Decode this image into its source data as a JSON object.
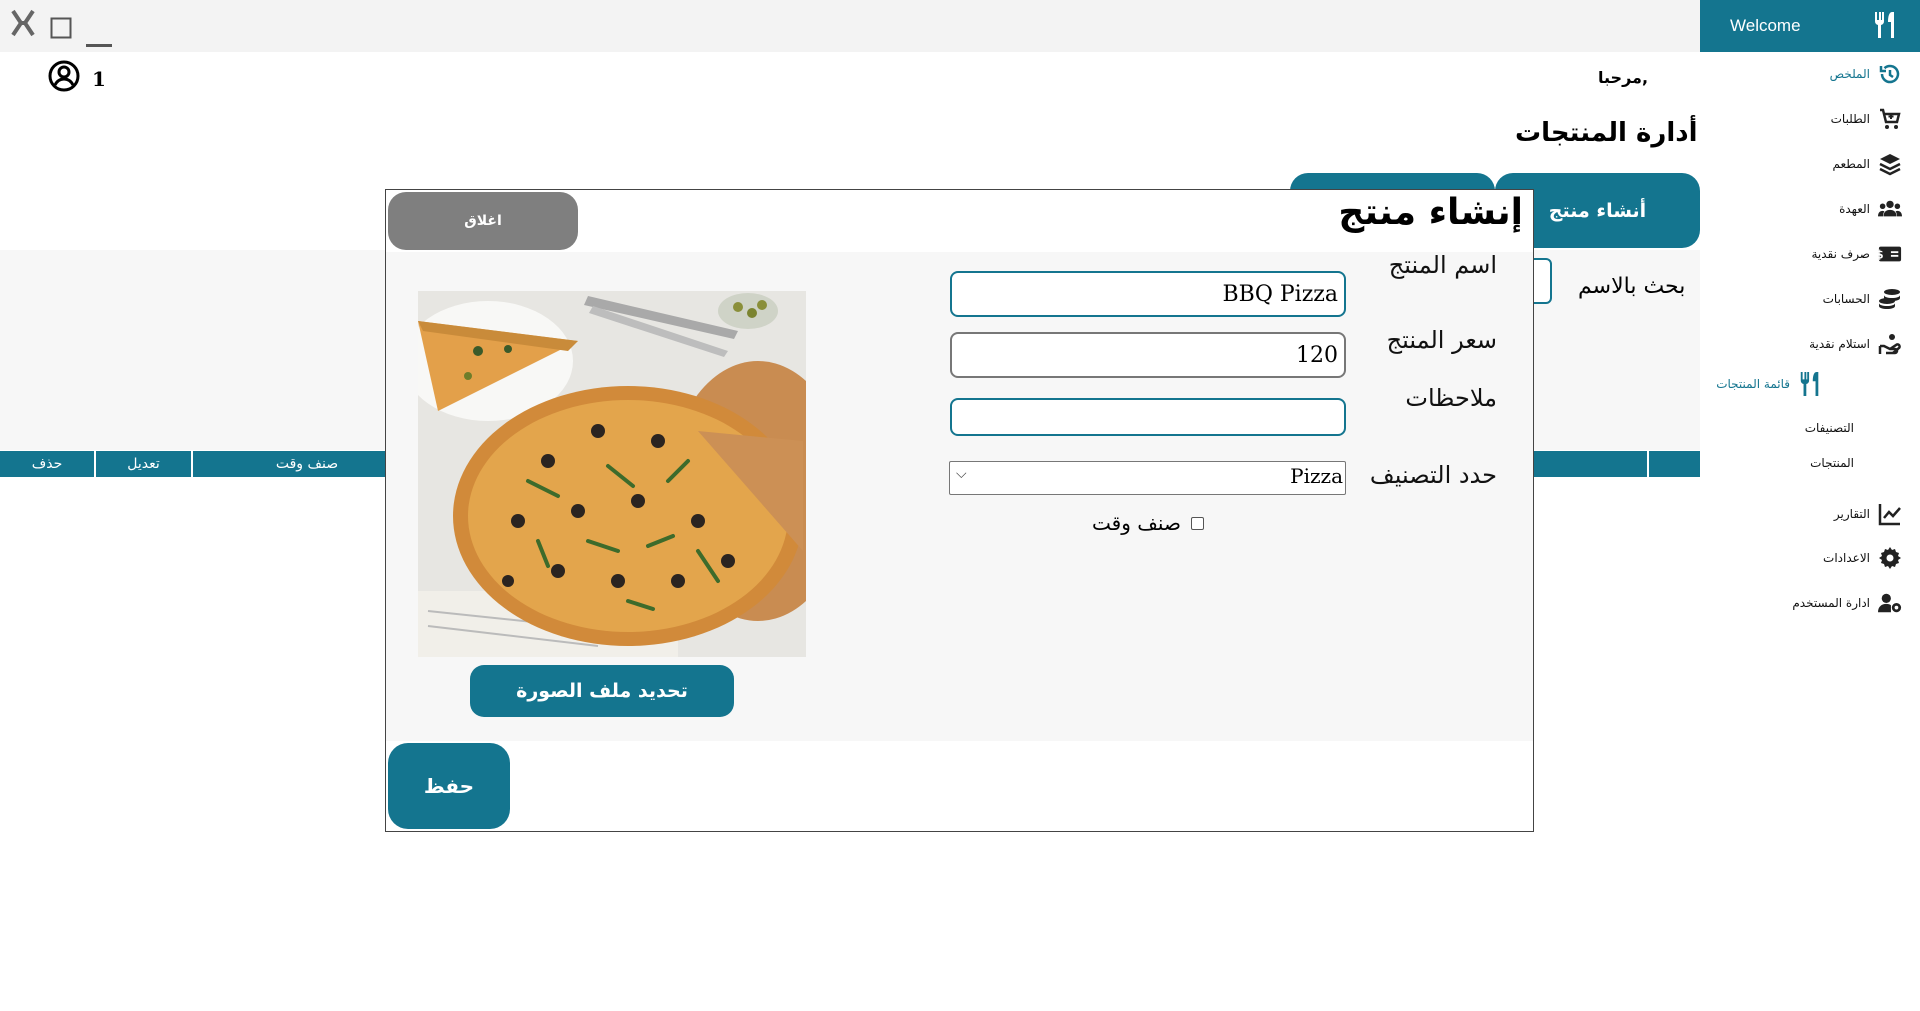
{
  "window": {
    "brand_label": "Welcome"
  },
  "colors": {
    "accent": "#14758f",
    "close_button": "#7f7f7f",
    "panel_bg": "#f7f7f7"
  },
  "header": {
    "user_number": "1",
    "greeting": "مرحبا,"
  },
  "page": {
    "title": "أدارة المنتجات",
    "create_tab": "أنشاء منتج",
    "search_label": "بحث بالاسم",
    "table_columns": [
      "حذف",
      "تعديل",
      "صنف وقت"
    ]
  },
  "sidebar": {
    "items": [
      {
        "label": "الملخص",
        "icon": "history-icon"
      },
      {
        "label": "الطلبات",
        "icon": "cart-icon"
      },
      {
        "label": "المطعم",
        "icon": "layers-icon"
      },
      {
        "label": "العهدة",
        "icon": "users-icon"
      },
      {
        "label": "صرف نقدية",
        "icon": "money-icon"
      },
      {
        "label": "الحسابات",
        "icon": "coins-icon"
      },
      {
        "label": "استلام نقدية",
        "icon": "hand-coins-icon"
      },
      {
        "label": "قائمة المنتجات",
        "icon": "utensils-icon"
      },
      {
        "label": "التقارير",
        "icon": "chart-line-icon"
      },
      {
        "label": "الاعدادات",
        "icon": "gear-icon"
      },
      {
        "label": "ادارة المستخدم",
        "icon": "user-gear-icon"
      }
    ],
    "subitems": [
      "التصنيفات",
      "المنتجات"
    ]
  },
  "modal": {
    "title": "إنشاء منتج",
    "close_label": "اغلاق",
    "name_label": "اسم المنتج",
    "name_value": "BBQ Pizza",
    "price_label": "سعر المنتج",
    "price_value": "120",
    "notes_label": "ملاحظات",
    "notes_value": "",
    "category_label": "حدد التصنيف",
    "category_value": "Pizza",
    "time_item_label": "صنف وقت",
    "upload_label": "تحديد ملف الصورة",
    "save_label": "حفظ"
  }
}
